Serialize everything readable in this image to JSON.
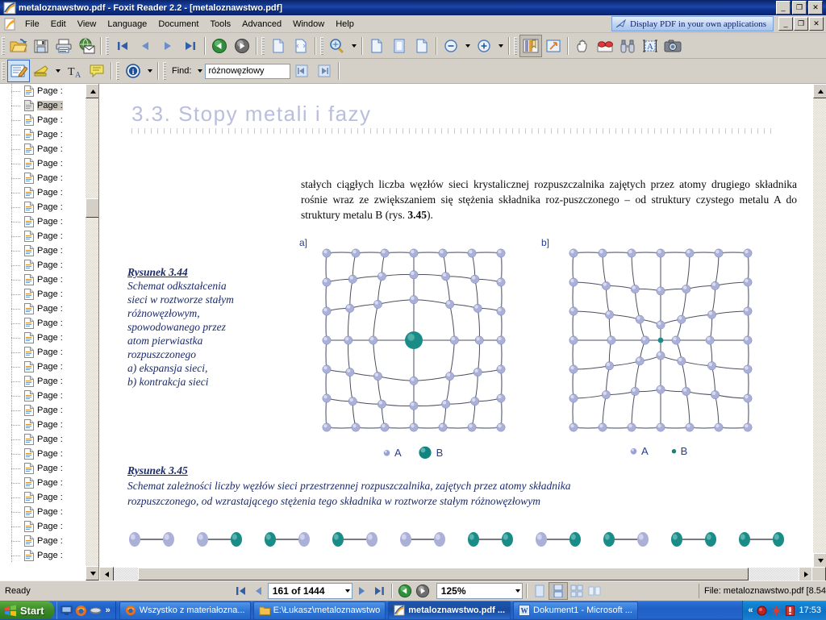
{
  "window": {
    "title": "metaloznawstwo.pdf - Foxit Reader 2.2 - [metaloznawstwo.pdf]",
    "icon": "foxit-icon",
    "minimize": "_",
    "maximize": "❐",
    "close": "✕"
  },
  "menu": {
    "items": [
      {
        "label": "File"
      },
      {
        "label": "Edit"
      },
      {
        "label": "View"
      },
      {
        "label": "Language"
      },
      {
        "label": "Document"
      },
      {
        "label": "Tools"
      },
      {
        "label": "Advanced"
      },
      {
        "label": "Window"
      },
      {
        "label": "Help"
      }
    ],
    "promo": "Display PDF in your own applications",
    "mdi": {
      "minimize": "_",
      "restore": "❐",
      "close": "✕"
    }
  },
  "toolbar1": {
    "buttons": [
      {
        "name": "open-button",
        "icon": "open-folder-icon"
      },
      {
        "name": "save-button",
        "icon": "floppy-disk-icon"
      },
      {
        "name": "print-button",
        "icon": "printer-icon"
      },
      {
        "name": "email-button",
        "icon": "globe-mail-icon"
      },
      {
        "name": "first-page-button",
        "icon": "first-page-icon"
      },
      {
        "name": "previous-page-button",
        "icon": "previous-page-icon"
      },
      {
        "name": "next-page-button",
        "icon": "next-page-icon"
      },
      {
        "name": "last-page-button",
        "icon": "last-page-icon"
      },
      {
        "name": "go-back-button",
        "icon": "back-arrow-icon"
      },
      {
        "name": "go-forward-button",
        "icon": "forward-arrow-icon"
      },
      {
        "name": "actual-size-button",
        "icon": "page-actual-size-icon"
      },
      {
        "name": "fit-page-button",
        "icon": "page-fit-icon"
      },
      {
        "name": "zoom-tool-button",
        "icon": "magnifier-icon"
      },
      {
        "name": "fit-width-button",
        "icon": "page-fit-width-icon"
      },
      {
        "name": "fit-visible-button",
        "icon": "page-fit-visible-icon"
      },
      {
        "name": "rotate-button",
        "icon": "page-rotate-icon"
      },
      {
        "name": "zoom-out-button",
        "icon": "zoom-out-icon"
      },
      {
        "name": "zoom-in-button",
        "icon": "zoom-in-icon"
      },
      {
        "name": "bookmarks-button",
        "icon": "bookmark-icon"
      },
      {
        "name": "fullscreen-button",
        "icon": "fullscreen-icon"
      },
      {
        "name": "hand-tool-button",
        "icon": "hand-icon"
      },
      {
        "name": "read-tool-button",
        "icon": "glasses-icon"
      },
      {
        "name": "find-button",
        "icon": "binoculars-icon"
      },
      {
        "name": "select-text-button",
        "icon": "select-text-icon"
      },
      {
        "name": "snapshot-button",
        "icon": "camera-icon"
      }
    ]
  },
  "toolbar2": {
    "buttons": [
      {
        "name": "edit-annotation-button",
        "icon": "pencil-note-icon"
      },
      {
        "name": "highlight-button",
        "icon": "highlighter-icon"
      },
      {
        "name": "text-tool-button",
        "icon": "text-a-icon"
      },
      {
        "name": "note-button",
        "icon": "sticky-note-icon"
      },
      {
        "name": "info-button",
        "icon": "info-circle-icon"
      },
      {
        "name": "find-previous-button",
        "icon": "find-previous-icon"
      },
      {
        "name": "find-next-button",
        "icon": "find-next-icon"
      }
    ],
    "find_label": "Find:",
    "find_value": "różnowęzłowy",
    "find_placeholder": "Find"
  },
  "sidebar": {
    "items": [
      {
        "label": "Page :",
        "selected": false
      },
      {
        "label": "Page :",
        "selected": true
      },
      {
        "label": "Page :",
        "selected": false
      },
      {
        "label": "Page :",
        "selected": false
      },
      {
        "label": "Page :",
        "selected": false
      },
      {
        "label": "Page :",
        "selected": false
      },
      {
        "label": "Page :",
        "selected": false
      },
      {
        "label": "Page :",
        "selected": false
      },
      {
        "label": "Page :",
        "selected": false
      },
      {
        "label": "Page :",
        "selected": false
      },
      {
        "label": "Page :",
        "selected": false
      },
      {
        "label": "Page :",
        "selected": false
      },
      {
        "label": "Page :",
        "selected": false
      },
      {
        "label": "Page :",
        "selected": false
      },
      {
        "label": "Page :",
        "selected": false
      },
      {
        "label": "Page :",
        "selected": false
      },
      {
        "label": "Page :",
        "selected": false
      },
      {
        "label": "Page :",
        "selected": false
      },
      {
        "label": "Page :",
        "selected": false
      },
      {
        "label": "Page :",
        "selected": false
      },
      {
        "label": "Page :",
        "selected": false
      },
      {
        "label": "Page :",
        "selected": false
      },
      {
        "label": "Page :",
        "selected": false
      },
      {
        "label": "Page :",
        "selected": false
      },
      {
        "label": "Page :",
        "selected": false
      },
      {
        "label": "Page :",
        "selected": false
      },
      {
        "label": "Page :",
        "selected": false
      },
      {
        "label": "Page :",
        "selected": false
      },
      {
        "label": "Page :",
        "selected": false
      },
      {
        "label": "Page :",
        "selected": false
      },
      {
        "label": "Page :",
        "selected": false
      },
      {
        "label": "Page :",
        "selected": false
      },
      {
        "label": "Page :",
        "selected": false
      }
    ],
    "scroll_up": "▲",
    "scroll_down": "▼"
  },
  "document": {
    "section_heading": "3.3.  Stopy metali i fazy",
    "paragraph": "stałych ciągłych liczba węzłów sieci krystalicznej rozpuszczalnika zajętych przez atomy drugiego składnika rośnie wraz ze zwiększaniem się stężenia składnika roz-puszczonego – od struktury czystego metalu A do struktury metalu B (rys. 3.45).",
    "figure_44": {
      "caption_title": "Rysunek 3.44",
      "caption_lines": [
        "Schemat odkształcenia",
        "sieci w roztworze stałym",
        "różnowęzłowym,",
        "spowodowanego przez",
        "atom pierwiastka",
        "rozpuszczonego",
        "a) ekspansja sieci,",
        "b) kontrakcja sieci"
      ],
      "panel_a_label": "a]",
      "panel_b_label": "b]",
      "legend_a": {
        "atom_a": "A",
        "atom_b": "B"
      },
      "legend_b": {
        "atom_a": "A",
        "atom_b": "B"
      }
    },
    "figure_45": {
      "caption_title": "Rysunek 3.45",
      "caption_lines": [
        "Schemat zależności liczby węzłów sieci przestrzennej rozpuszczalnika, zajętych przez atomy składnika",
        "rozpuszczonego, od wzrastającego stężenia tego składnika w roztworze stałym różnowęzłowym"
      ]
    },
    "colors": {
      "heading": "#b9bede",
      "atom_a": "#aab0d8",
      "atom_b": "#1a8c88",
      "caption": "#1b2a6b"
    }
  },
  "statusbar": {
    "status": "Ready",
    "first_page": "first-page-icon",
    "prev_page": "previous-page-icon",
    "page_value": "161 of 1444",
    "next_page": "next-page-icon",
    "last_page": "last-page-icon",
    "back": "back-arrow-icon",
    "forward": "forward-arrow-icon",
    "zoom_value": "125%",
    "view_single": "single-page-view-icon",
    "view_continuous": "continuous-view-icon",
    "view_facing": "facing-view-icon",
    "view_continuous_facing": "continuous-facing-view-icon",
    "file_info": "File: metaloznawstwo.pdf [8.54"
  },
  "taskbar": {
    "start": "Start",
    "quicklaunch": [
      {
        "name": "show-desktop-icon"
      },
      {
        "name": "firefox-icon"
      },
      {
        "name": "media-icon"
      },
      {
        "name": "more-chevrons-icon",
        "label": "»"
      }
    ],
    "tasks": [
      {
        "label": "Wszystko z materiałozna...",
        "icon": "firefox-icon",
        "active": false
      },
      {
        "label": "E:\\Łukasz\\metaloznawstwo",
        "icon": "folder-icon",
        "active": false
      },
      {
        "label": "metaloznawstwo.pdf ...",
        "icon": "foxit-icon",
        "active": true
      },
      {
        "label": "Dokument1 - Microsoft ...",
        "icon": "word-icon",
        "active": false
      }
    ],
    "tray": {
      "expand": "«",
      "icons": [
        "tray-record-icon",
        "tray-sun-icon",
        "tray-alert-icon"
      ],
      "clock": "17:53"
    }
  }
}
